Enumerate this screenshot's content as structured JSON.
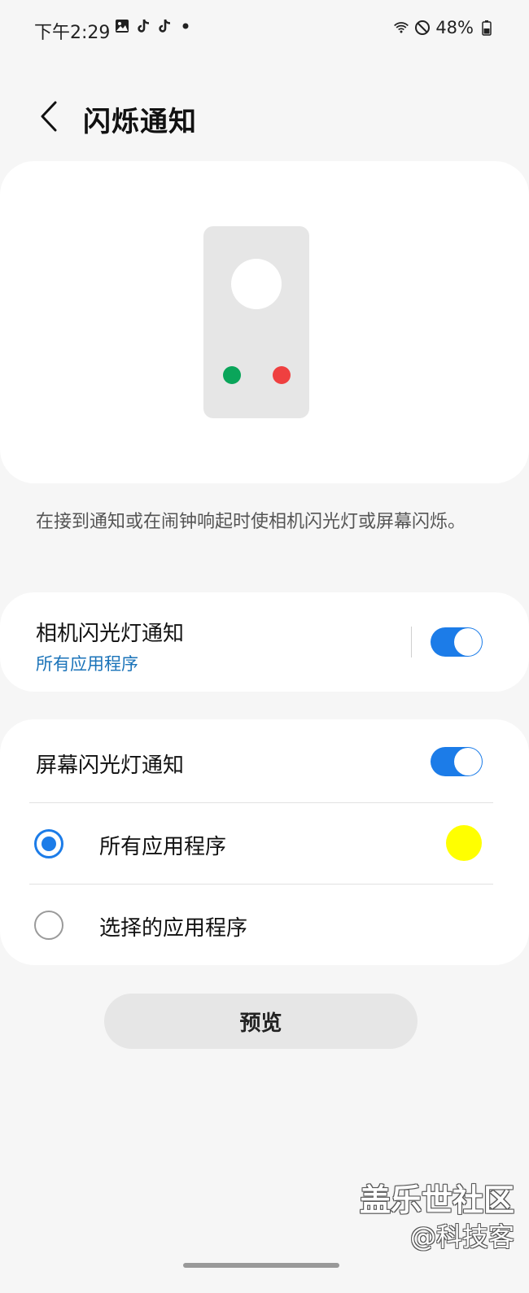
{
  "status_bar": {
    "time": "下午2:29",
    "battery": "48%",
    "left_icons": [
      "gallery-icon",
      "tiktok-icon",
      "tiktok-icon",
      "dot-icon"
    ],
    "right_icons": [
      "wifi-icon",
      "do-not-disturb-icon",
      "battery-icon"
    ]
  },
  "header": {
    "title": "闪烁通知"
  },
  "description": "在接到通知或在闹钟响起时使相机闪光灯或屏幕闪烁。",
  "camera_flash": {
    "title": "相机闪光灯通知",
    "subtitle": "所有应用程序",
    "enabled": true
  },
  "screen_flash": {
    "title": "屏幕闪光灯通知",
    "enabled": true,
    "options": [
      {
        "label": "所有应用程序",
        "selected": true
      },
      {
        "label": "选择的应用程序",
        "selected": false
      }
    ],
    "color": "#ffff00"
  },
  "preview_button": "预览",
  "watermark": {
    "line1": "盖乐世社区",
    "line2": "@科技客"
  },
  "colors": {
    "accent": "#1c7ce8",
    "link": "#1a73b9",
    "green_dot": "#0aa55a",
    "red_dot": "#ef4040"
  }
}
